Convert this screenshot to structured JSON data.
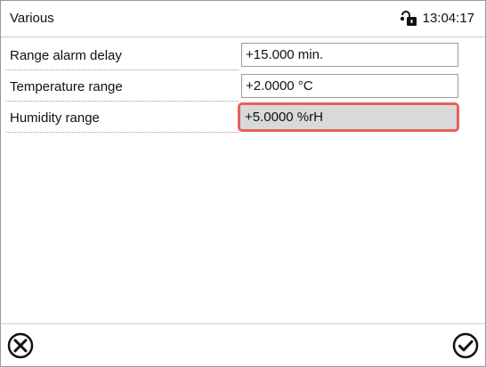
{
  "header": {
    "title": "Various",
    "time": "13:04:17",
    "status_icon": "lock-icon"
  },
  "rows": [
    {
      "label": "Range alarm delay",
      "value": "+15.000 min."
    },
    {
      "label": "Temperature range",
      "value": "+2.0000 °C"
    },
    {
      "label": "Humidity range",
      "value": "+5.0000 %rH"
    }
  ],
  "selected_row": 2,
  "footer": {
    "left_icon": "cancel-icon",
    "right_icon": "confirm-icon"
  },
  "colors": {
    "highlight": "#e85f5f",
    "selected_field_bg": "#d9d9d9"
  }
}
